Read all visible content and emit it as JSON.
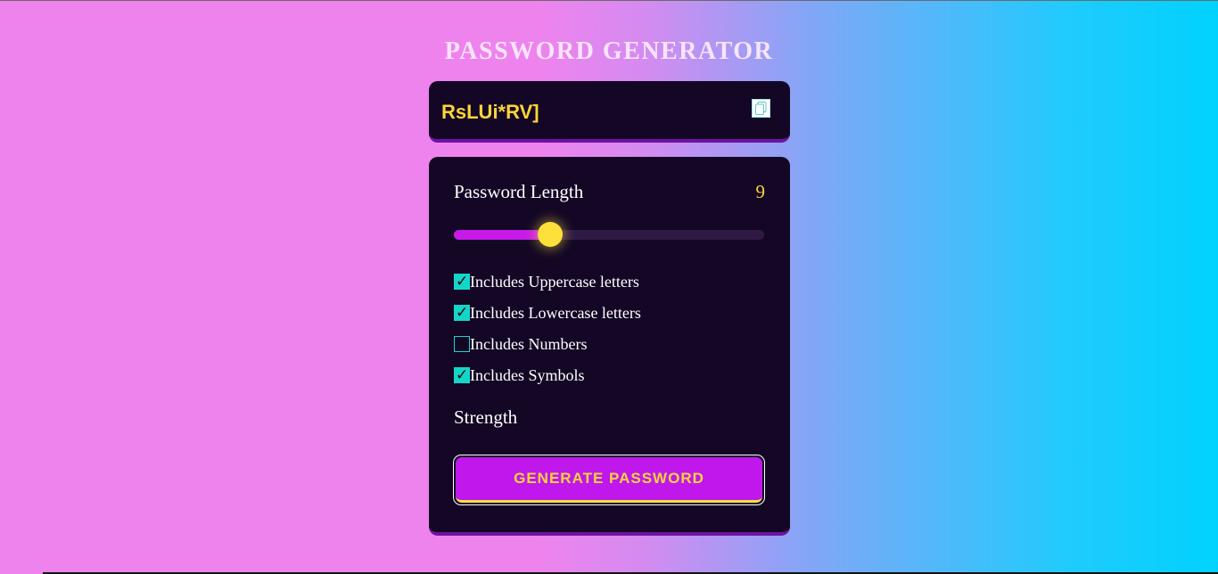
{
  "app": {
    "title": "PASSWORD GENERATOR"
  },
  "display": {
    "password": "RsLUi*RV]",
    "copy_icon": "copy-icon"
  },
  "length": {
    "label": "Password Length",
    "value": "9",
    "slider_fraction": 0.31
  },
  "options": [
    {
      "label": "Includes Uppercase letters",
      "checked": true
    },
    {
      "label": "Includes Lowercase letters",
      "checked": true
    },
    {
      "label": "Includes Numbers",
      "checked": false
    },
    {
      "label": "Includes Symbols",
      "checked": true
    }
  ],
  "strength": {
    "label": "Strength"
  },
  "generate": {
    "label": "GENERATE PASSWORD"
  },
  "colors": {
    "accent": "#c71ae8",
    "highlight": "#fdd43a",
    "check": "#13d6c8",
    "panel": "#130725"
  }
}
